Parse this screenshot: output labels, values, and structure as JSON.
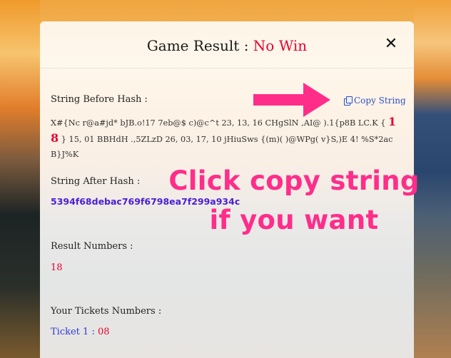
{
  "modal": {
    "title_prefix": "Game Result : ",
    "title_result": "No Win",
    "close_symbol": "✕"
  },
  "string_before_hash": {
    "label": "String Before Hash :",
    "copy_label": "Copy String",
    "text_part1": "X#{Nc r@a#jd* bJB.o!17 7eb@$ c)@c^t 23, 13, 16 CHgSlN ,AI@ ).1{p8B LC.K {",
    "text_highlight": "18",
    "text_part2": "} 15, 01 BBHdH .,5ZLzD 26, 03, 17, 10 jHiuSws {(m)( )@WPg( v}S,)E 4! %S*2ac B}J%K"
  },
  "string_after_hash": {
    "label": "String After Hash :",
    "value": "5394f68debac769f6798ea7f299a934c"
  },
  "result_numbers": {
    "label": "Result Numbers :",
    "value": "18"
  },
  "tickets": {
    "label": "Your Tickets Numbers :",
    "ticket_label": "Ticket  1 : ",
    "ticket_value": "08"
  },
  "annotation": {
    "line1": "Click copy string",
    "line2": "if  you want",
    "color": "#ff2d8a"
  },
  "colors": {
    "result_red": "#e8002d",
    "link_blue": "#2c52c4",
    "hash_purple": "#4a1ed6"
  }
}
